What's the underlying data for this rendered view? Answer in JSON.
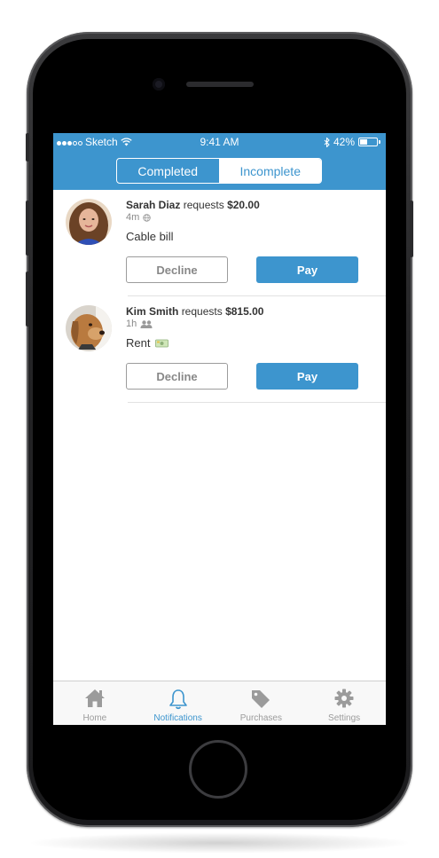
{
  "status_bar": {
    "carrier": "Sketch",
    "time": "9:41 AM",
    "battery": "42%",
    "battery_level": 0.42
  },
  "segmented_control": {
    "completed_label": "Completed",
    "incomplete_label": "Incomplete",
    "selected": "Incomplete"
  },
  "requests": [
    {
      "name": "Sarah Diaz",
      "action": "requests",
      "amount": "$20.00",
      "time": "4m",
      "privacy_icon": "globe-icon",
      "note": "Cable bill",
      "decline_label": "Decline",
      "pay_label": "Pay"
    },
    {
      "name": "Kim Smith",
      "action": "requests",
      "amount": "$815.00",
      "time": "1h",
      "privacy_icon": "friends-icon",
      "note": "Rent",
      "note_icon": "money-icon",
      "decline_label": "Decline",
      "pay_label": "Pay"
    }
  ],
  "tab_bar": {
    "items": [
      {
        "label": "Home",
        "icon": "home-icon"
      },
      {
        "label": "Notifications",
        "icon": "bell-icon",
        "active": true
      },
      {
        "label": "Purchases",
        "icon": "tag-icon"
      },
      {
        "label": "Settings",
        "icon": "gear-icon"
      }
    ]
  },
  "colors": {
    "accent": "#3d95ce",
    "tab_inactive": "#9b9b9b",
    "divider": "#e2e2e2"
  }
}
